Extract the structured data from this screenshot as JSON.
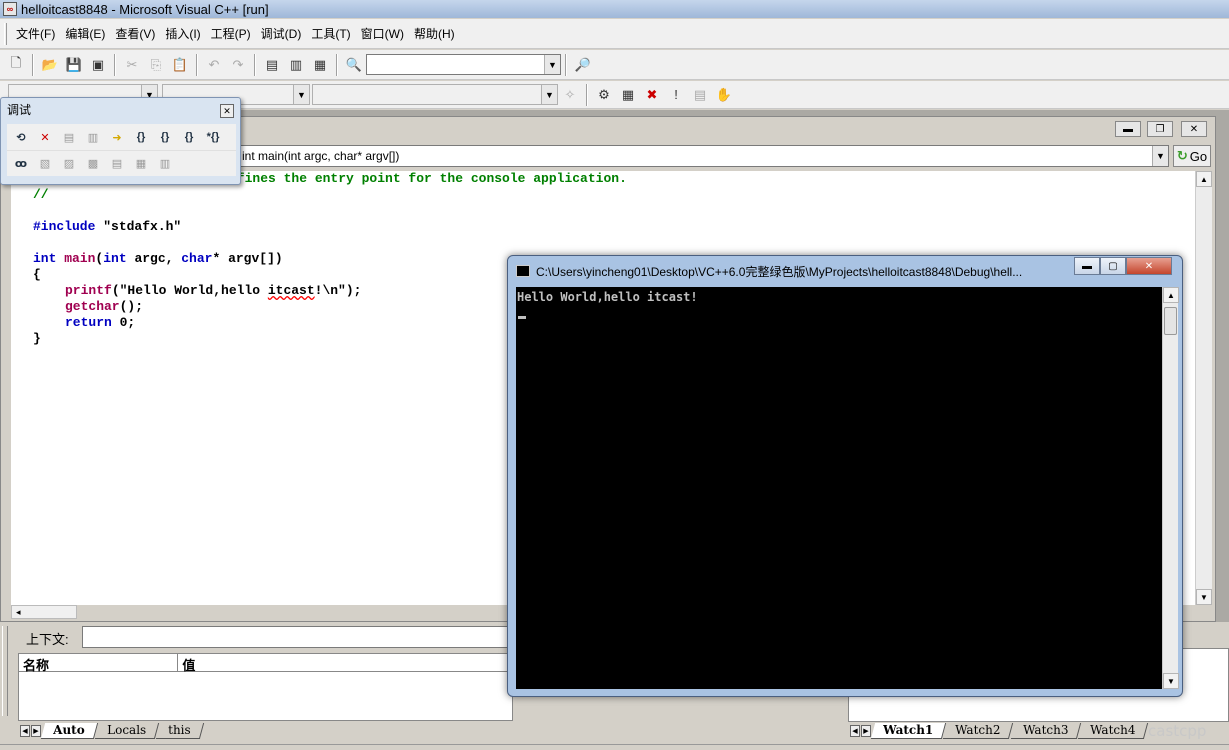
{
  "window": {
    "title": "helloitcast8848 - Microsoft Visual C++ [run]"
  },
  "menu": [
    {
      "label": "文件(F)"
    },
    {
      "label": "编辑(E)"
    },
    {
      "label": "查看(V)"
    },
    {
      "label": "插入(I)"
    },
    {
      "label": "工程(P)"
    },
    {
      "label": "调试(D)"
    },
    {
      "label": "工具(T)"
    },
    {
      "label": "窗口(W)"
    },
    {
      "label": "帮助(H)"
    }
  ],
  "debug_toolbar": {
    "title": "调试",
    "close": "✕"
  },
  "editor": {
    "function_combo": "int main(int argc, char* argv[])",
    "go_label": "Go",
    "code": {
      "line1_rest": "efines the entry point for the console application.",
      "line2": "//",
      "include_kw": "#include",
      "include_file": " \"stdafx.h\"",
      "main_int": "int",
      "main_name": " main",
      "main_paren": "(",
      "main_int2": "int",
      "main_argc": " argc, ",
      "main_char": "char",
      "main_rest": "* argv[])",
      "brace_open": "{",
      "printf_fn": "printf",
      "printf_a": "(\"Hello World,hello ",
      "printf_b": "itcast",
      "printf_c": "!\\n\");",
      "getchar_fn": "getchar",
      "getchar_rest": "();",
      "return_kw": "return",
      "return_rest": " 0;",
      "brace_close": "}"
    }
  },
  "bottom": {
    "context_label": "上下文:",
    "col_name": "名称",
    "col_value": "值",
    "var_tabs": [
      {
        "label": "Auto",
        "active": true
      },
      {
        "label": "Locals"
      },
      {
        "label": "this"
      }
    ],
    "watch_tabs": [
      {
        "label": "Watch1",
        "active": true
      },
      {
        "label": "Watch2"
      },
      {
        "label": "Watch3"
      },
      {
        "label": "Watch4"
      }
    ],
    "watermark": "castcpp"
  },
  "console": {
    "title": "C:\\Users\\yincheng01\\Desktop\\VC++6.0完整绿色版\\MyProjects\\helloitcast8848\\Debug\\hell...",
    "output": "Hello World,hello itcast!"
  }
}
